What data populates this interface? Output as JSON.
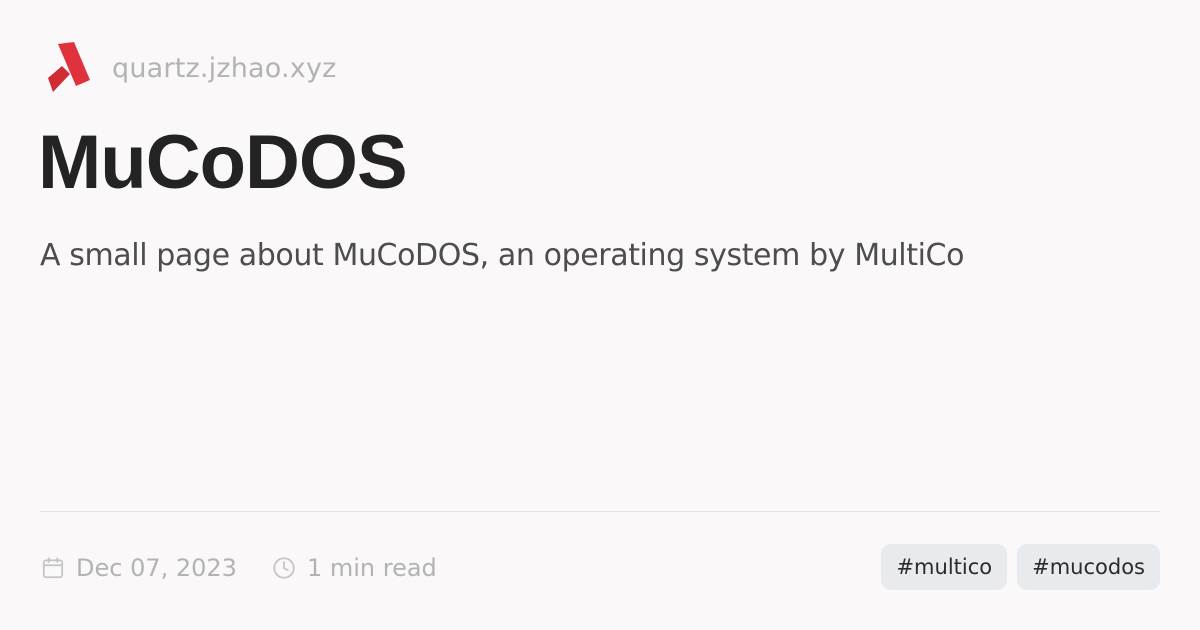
{
  "header": {
    "logo_icon": "quartz-logo-icon",
    "site_domain": "quartz.jzhao.xyz"
  },
  "page": {
    "title": "MuCoDOS",
    "description": "A small page about MuCoDOS, an operating system by MultiCo"
  },
  "meta": {
    "date_icon": "calendar-icon",
    "date": "Dec 07, 2023",
    "reading_time_icon": "clock-icon",
    "reading_time": "1 min read"
  },
  "tags": [
    "#multico",
    "#mucodos"
  ],
  "colors": {
    "background": "#faf8f8",
    "logo_red": "#e0323c",
    "title": "#232323",
    "muted_text": "#b3b3b3",
    "tag_background": "#e8eaed"
  }
}
